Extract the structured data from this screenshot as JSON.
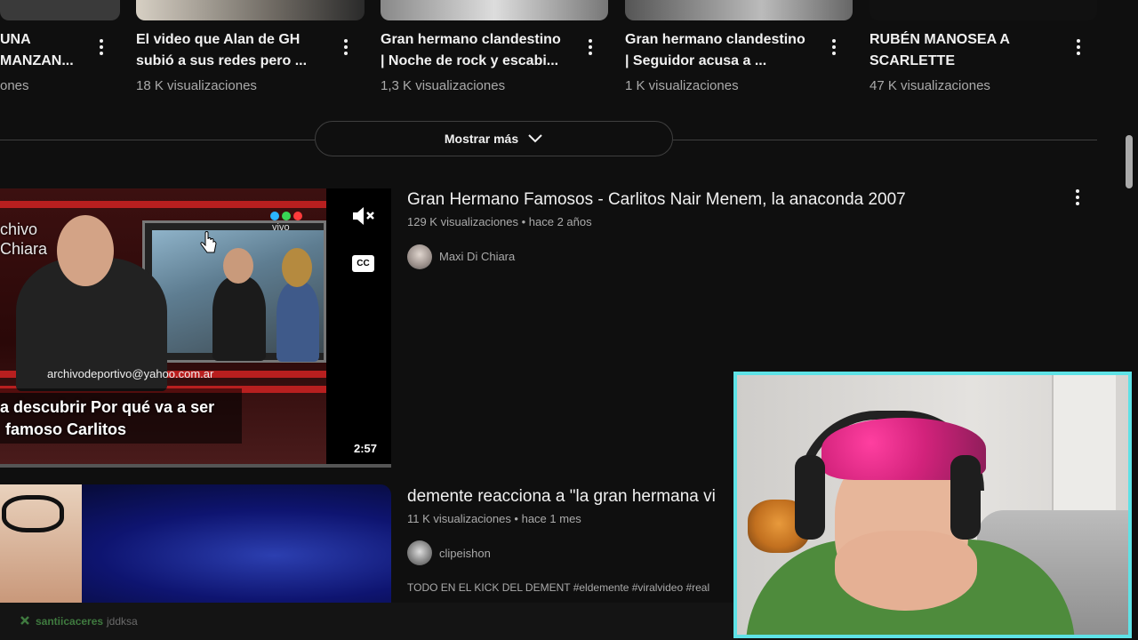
{
  "shelf": [
    {
      "title_line1": "UNA",
      "title_line2": "MANZAN...",
      "meta": "ones"
    },
    {
      "title_line1": "El video que Alan de GH",
      "title_line2": "subió a sus redes pero ...",
      "meta": "18 K visualizaciones"
    },
    {
      "title_line1": "Gran hermano clandestino",
      "title_line2": "| Noche de rock y escabi...",
      "meta": "1,3 K visualizaciones"
    },
    {
      "title_line1": "Gran hermano clandestino",
      "title_line2": "| Seguidor acusa a ...",
      "meta": "1 K visualizaciones"
    },
    {
      "title_line1": "RUBÉN MANOSEA A",
      "title_line2": "SCARLETTE",
      "meta": "47 K visualizaciones"
    }
  ],
  "show_more": {
    "label": "Mostrar más"
  },
  "videos": [
    {
      "title": "Gran Hermano Famosos - Carlitos Nair Menem, la anaconda 2007",
      "meta": "129 K visualizaciones • hace 2 años",
      "channel": "Maxi Di Chiara",
      "duration": "2:57",
      "progress_fraction": 1.0,
      "thumb_text": {
        "logo_line1": "chivo",
        "logo_line2": "Chiara",
        "email": "archivodeportivo@yahoo.com.ar",
        "caption_line1": "a descubrir Por qué va a ser",
        "caption_line2": "famoso Carlitos",
        "channel_logo": "vivo"
      },
      "controls": {
        "mute_icon": "muted-speaker-icon",
        "cc_label": "CC"
      }
    },
    {
      "title": "demente reacciona a \"la gran hermana vi",
      "meta": "11 K visualizaciones • hace 1 mes",
      "channel": "clipeishon",
      "description": "TODO EN EL KICK DEL DEMENT #eldemente #viralvideo #real"
    }
  ],
  "chat": {
    "user": "santiicaceres",
    "message": "jddksa"
  },
  "colors": {
    "background": "#0f0f0f",
    "webcam_border": "#5ee2e6",
    "text_primary": "#f1f1f1",
    "text_secondary": "#aaaaaa"
  }
}
